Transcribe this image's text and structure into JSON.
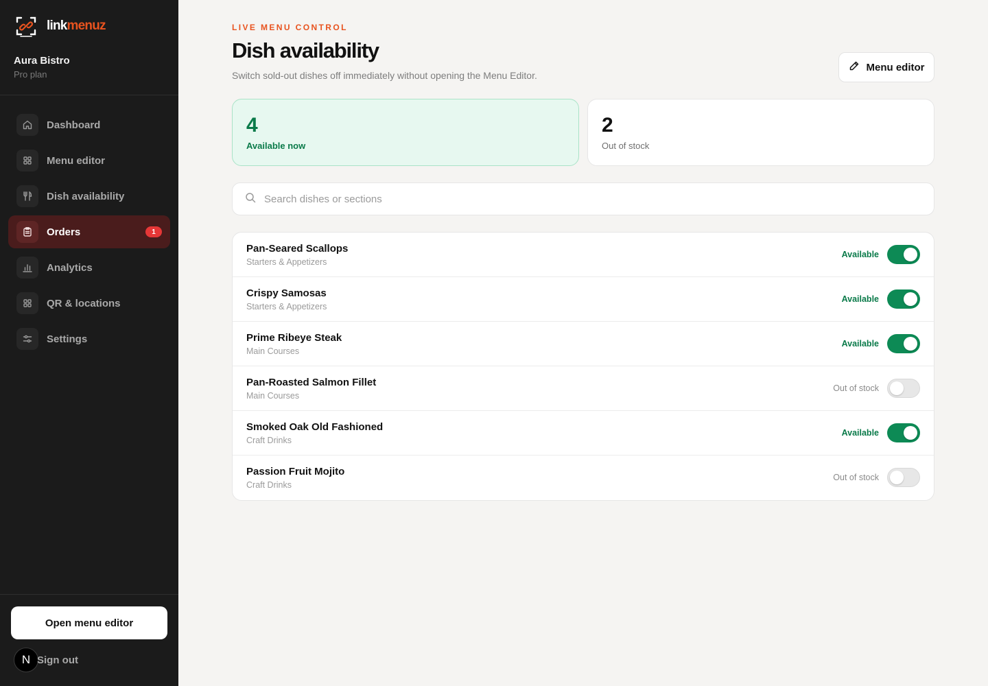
{
  "brand": {
    "name_link": "link",
    "name_menuz": "menuz",
    "logo_icon": "qr-frame-link-icon",
    "accent": "#e8531f"
  },
  "account": {
    "name": "Aura Bistro",
    "plan": "Pro plan"
  },
  "sidebar": {
    "items": [
      {
        "label": "Dashboard",
        "icon": "home-icon",
        "active": false
      },
      {
        "label": "Menu editor",
        "icon": "grid-icon",
        "active": false
      },
      {
        "label": "Dish availability",
        "icon": "utensils-icon",
        "active": false
      },
      {
        "label": "Orders",
        "icon": "clipboard-icon",
        "active": true,
        "badge": "1"
      },
      {
        "label": "Analytics",
        "icon": "bar-chart-icon",
        "active": false
      },
      {
        "label": "QR & locations",
        "icon": "qr-grid-icon",
        "active": false
      },
      {
        "label": "Settings",
        "icon": "sliders-icon",
        "active": false
      }
    ],
    "open_editor_label": "Open menu editor",
    "avatar_letter": "N",
    "signout_label": "Sign out"
  },
  "header": {
    "eyebrow": "LIVE MENU CONTROL",
    "title": "Dish availability",
    "subtitle": "Switch sold-out dishes off immediately without opening the Menu Editor.",
    "button_label": "Menu editor",
    "button_icon": "pencil-icon"
  },
  "stats": {
    "available_count": "4",
    "available_label": "Available now",
    "out_count": "2",
    "out_label": "Out of stock"
  },
  "search": {
    "placeholder": "Search dishes or sections",
    "value": ""
  },
  "dishes": [
    {
      "name": "Pan-Seared Scallops",
      "section": "Starters & Appetizers",
      "status": "Available",
      "on": true
    },
    {
      "name": "Crispy Samosas",
      "section": "Starters & Appetizers",
      "status": "Available",
      "on": true
    },
    {
      "name": "Prime Ribeye Steak",
      "section": "Main Courses",
      "status": "Available",
      "on": true
    },
    {
      "name": "Pan-Roasted Salmon Fillet",
      "section": "Main Courses",
      "status": "Out of stock",
      "on": false
    },
    {
      "name": "Smoked Oak Old Fashioned",
      "section": "Craft Drinks",
      "status": "Available",
      "on": true
    },
    {
      "name": "Passion Fruit Mojito",
      "section": "Craft Drinks",
      "status": "Out of stock",
      "on": false
    }
  ],
  "colors": {
    "available_green": "#0d8a55",
    "active_nav": "#4a1c1c",
    "badge_red": "#e63737"
  }
}
